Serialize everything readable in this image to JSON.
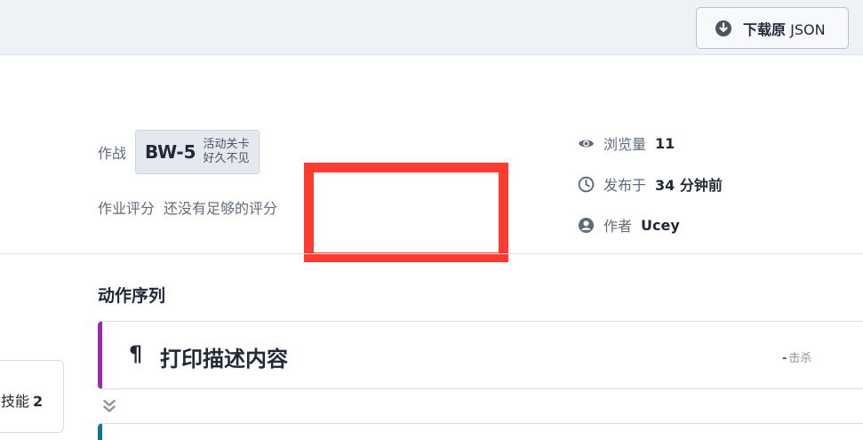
{
  "toolbar": {
    "download_label_strong": "下载原",
    "download_label_thin": "JSON"
  },
  "operation": {
    "stage_label": "作战",
    "stage_code": "BW-5",
    "stage_event": "活动关卡",
    "stage_note": "好久不见",
    "rating_label": "作业评分",
    "rating_value": "还没有足够的评分"
  },
  "meta": {
    "views_label": "浏览量",
    "views_value": "11",
    "published_label": "发布于",
    "published_value": "34 分钟前",
    "author_label": "作者",
    "author_value": "Ucey"
  },
  "actions": {
    "section_title": "动作序列",
    "items": [
      {
        "symbol": "¶",
        "title": "打印描述内容",
        "kill_dash": "-",
        "kill_label": "击杀",
        "accent_color": "#9c27b0"
      }
    ],
    "next_accent_color": "#0e7490"
  },
  "side": {
    "skill_label": "技能",
    "skill_value": "2"
  },
  "colors": {
    "highlight": "#ff3b30",
    "topbar_bg": "#eef2f6"
  }
}
